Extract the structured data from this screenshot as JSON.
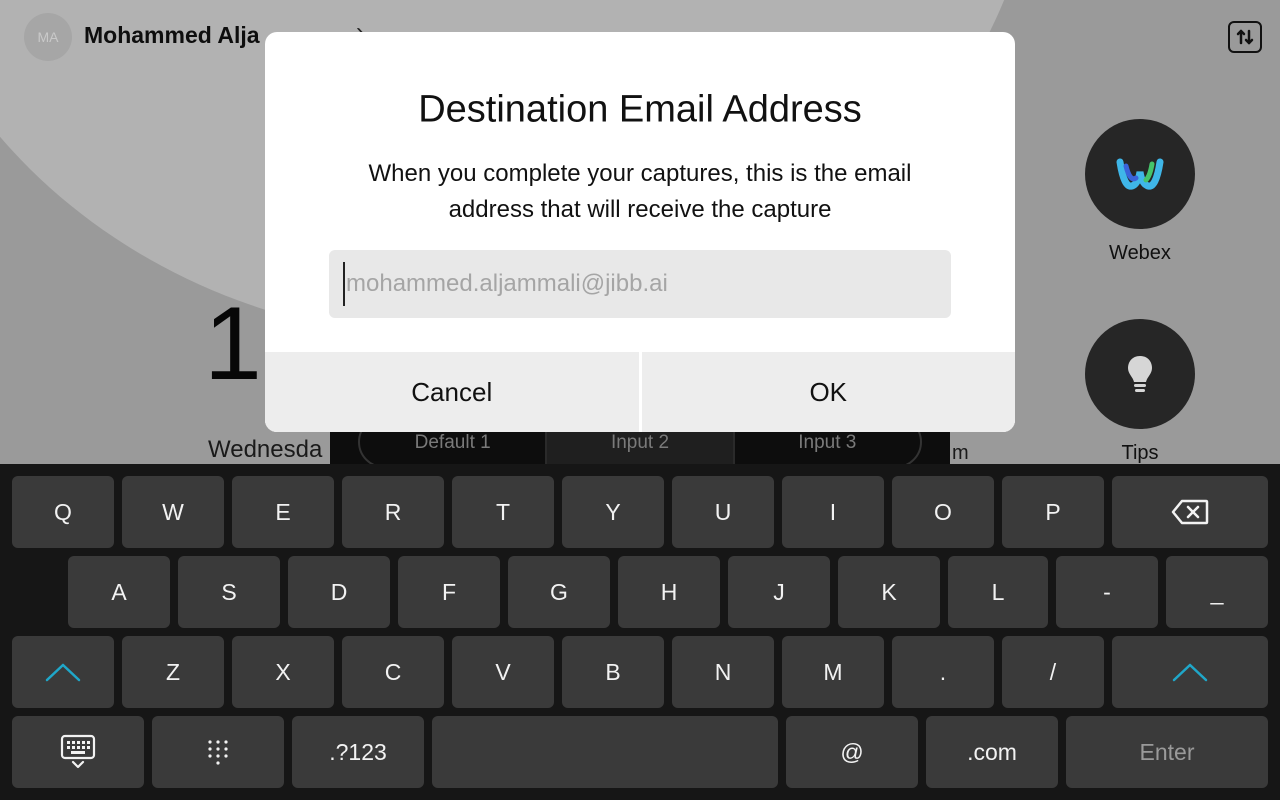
{
  "home": {
    "avatar_initials": "MA",
    "user_name": "Mohammed Alja",
    "user_chevron": "›",
    "settings_icon": "swap-settings-icon",
    "clock_digit": "1",
    "date_text": "Wednesda",
    "room_text": "m",
    "tiles": [
      {
        "label": "Webex",
        "icon": "webex-logo-icon"
      },
      {
        "label": "Tips",
        "icon": "lightbulb-icon"
      }
    ],
    "inputs": [
      "Default 1",
      "Input 2",
      "Input 3"
    ]
  },
  "dialog": {
    "title": "Destination Email Address",
    "message": "When you complete your captures, this is the email address that will receive the capture",
    "email_placeholder": "mohammed.aljammali@jibb.ai",
    "cancel_label": "Cancel",
    "ok_label": "OK"
  },
  "keyboard": {
    "row1": [
      "Q",
      "W",
      "E",
      "R",
      "T",
      "Y",
      "U",
      "I",
      "O",
      "P"
    ],
    "row2": [
      "A",
      "S",
      "D",
      "F",
      "G",
      "H",
      "J",
      "K",
      "L",
      "-",
      "_"
    ],
    "row3": [
      "Z",
      "X",
      "C",
      "V",
      "B",
      "N",
      "M",
      ".",
      "/"
    ],
    "numbers_label": ".?123",
    "at_label": "@",
    "dotcom_label": ".com",
    "enter_label": "Enter",
    "accent_color": "#1fa7c9"
  }
}
